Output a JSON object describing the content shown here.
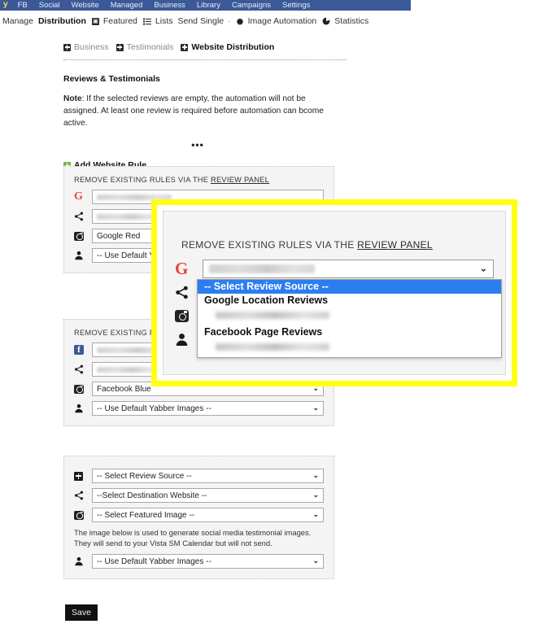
{
  "topnav": {
    "logo": "y",
    "items": [
      "FB",
      "Social",
      "Website",
      "Managed",
      "Business",
      "Library",
      "Campaigns",
      "Settings"
    ]
  },
  "subnav": {
    "manage": "Manage",
    "distribution": "Distribution",
    "featured": "Featured",
    "lists": "Lists",
    "send_single": "Send Single",
    "separator": "·",
    "image_automation": "Image Automation",
    "statistics": "Statistics"
  },
  "tabs": [
    {
      "label": "Business",
      "active": false
    },
    {
      "label": "Testimonials",
      "active": false
    },
    {
      "label": "Website Distribution",
      "active": true
    }
  ],
  "section": {
    "title": "Reviews & Testimonials",
    "note_bold": "Note",
    "note_text": ": If the selected reviews are empty, the automation will not be assigned. At least one review is required before automation can bcome active.",
    "ellipsis": "•••",
    "add_rule": "Add Website Rule"
  },
  "cards": [
    {
      "label_prefix": "REMOVE EXISTING RULES VIA THE ",
      "label_link": "REVIEW PANEL",
      "source_icon": "google-g-icon",
      "rows": [
        {
          "icon": "google-g-icon",
          "value": "",
          "blurred": true
        },
        {
          "icon": "share-icon",
          "value": "",
          "blurred": true
        },
        {
          "icon": "camera-icon",
          "value": "Google Red",
          "blurred": false
        },
        {
          "icon": "person-icon",
          "value": "-- Use Default Yabber Images --",
          "blurred": false
        }
      ]
    },
    {
      "label_prefix": "REMOVE EXISTING RULES VIA THE ",
      "label_link": "REVIEW PANEL",
      "source_icon": "facebook-icon",
      "rows": [
        {
          "icon": "facebook-icon",
          "value": "",
          "blurred": true
        },
        {
          "icon": "share-icon",
          "value": "",
          "blurred": true
        },
        {
          "icon": "camera-icon",
          "value": "Facebook Blue",
          "blurred": false
        },
        {
          "icon": "person-icon",
          "value": "-- Use Default Yabber Images --",
          "blurred": false
        }
      ]
    },
    {
      "label_prefix": "",
      "label_link": "",
      "source_icon": "plus-icon",
      "helper_text": "The image below is used to generate social media testimonial images. They will send to your Vista SM Calendar but will not send.",
      "rows": [
        {
          "icon": "plus-icon",
          "value": "-- Select Review Source --",
          "blurred": false
        },
        {
          "icon": "share-icon",
          "value": "--Select Destination Website --",
          "blurred": false
        },
        {
          "icon": "camera-icon",
          "value": "-- Select Featured Image --",
          "blurred": false
        },
        {
          "icon": "person-icon",
          "value": "-- Use Default Yabber Images --",
          "blurred": false
        }
      ]
    }
  ],
  "callout": {
    "label_prefix": "REMOVE EXISTING RULES VIA THE ",
    "label_link": "REVIEW PANEL",
    "border_color": "#ffff14",
    "rows": [
      {
        "icon": "google-g-icon",
        "value": "",
        "blurred": true
      },
      {
        "icon": "share-icon",
        "value": "",
        "blurred": true
      },
      {
        "icon": "camera-icon",
        "value": "",
        "blurred": true
      },
      {
        "icon": "person-icon",
        "value": "-- Use Default Yabber Images --",
        "blurred": false
      }
    ],
    "dropdown": {
      "open": true,
      "highlight_color": "#2c7ef0",
      "options": [
        {
          "label": "-- Select Review Source --",
          "type": "placeholder",
          "selected": true
        },
        {
          "label": "Google Location Reviews",
          "type": "group"
        },
        {
          "label": "",
          "type": "blurred"
        },
        {
          "label": "Facebook Page Reviews",
          "type": "group"
        },
        {
          "label": "",
          "type": "blurred"
        }
      ]
    }
  },
  "footer": {
    "save_label": "Save"
  }
}
